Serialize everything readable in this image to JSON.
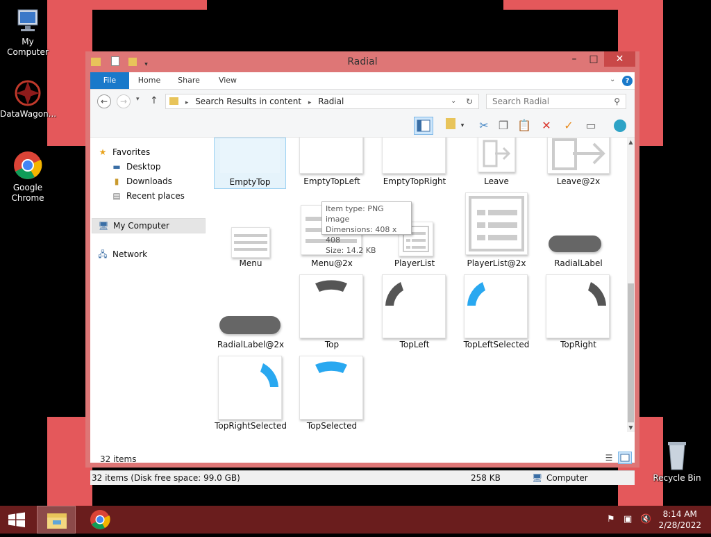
{
  "desktop": {
    "icons": [
      {
        "label": "My Computer"
      },
      {
        "label": "DataWagon..."
      },
      {
        "label": "Google Chrome"
      },
      {
        "label": "Recycle Bin"
      }
    ]
  },
  "window": {
    "title": "Radial",
    "ribbon_tabs": [
      "File",
      "Home",
      "Share",
      "View"
    ],
    "address": {
      "crumbs": [
        "Search Results in content",
        "Radial"
      ]
    },
    "search": {
      "placeholder": "Search Radial"
    },
    "nav": {
      "favorites_label": "Favorites",
      "favorites_items": [
        "Desktop",
        "Downloads",
        "Recent places"
      ],
      "computer_label": "My Computer",
      "network_label": "Network"
    },
    "items": [
      {
        "name": "EmptyTop"
      },
      {
        "name": "EmptyTopLeft"
      },
      {
        "name": "EmptyTopRight"
      },
      {
        "name": "Leave"
      },
      {
        "name": "Leave@2x"
      },
      {
        "name": "Menu"
      },
      {
        "name": "Menu@2x"
      },
      {
        "name": "PlayerList"
      },
      {
        "name": "PlayerList@2x"
      },
      {
        "name": "RadialLabel"
      },
      {
        "name": "RadialLabel@2x"
      },
      {
        "name": "Top"
      },
      {
        "name": "TopLeft"
      },
      {
        "name": "TopLeftSelected"
      },
      {
        "name": "TopRight"
      },
      {
        "name": "TopRightSelected"
      },
      {
        "name": "TopSelected"
      }
    ],
    "tooltip": {
      "type": "Item type: PNG image",
      "dimensions": "Dimensions: 408 x 408",
      "size": "Size: 14.2 KB"
    },
    "item_count": "32 items",
    "status": {
      "left": "32 items (Disk free space: 99.0 GB)",
      "size": "258 KB",
      "location": "Computer"
    }
  },
  "taskbar": {
    "time": "8:14 AM",
    "date": "2/28/2022"
  },
  "colors": {
    "accent": "#1979ca",
    "selected_blue": "#29a8f0",
    "gray_shape": "#555555"
  }
}
